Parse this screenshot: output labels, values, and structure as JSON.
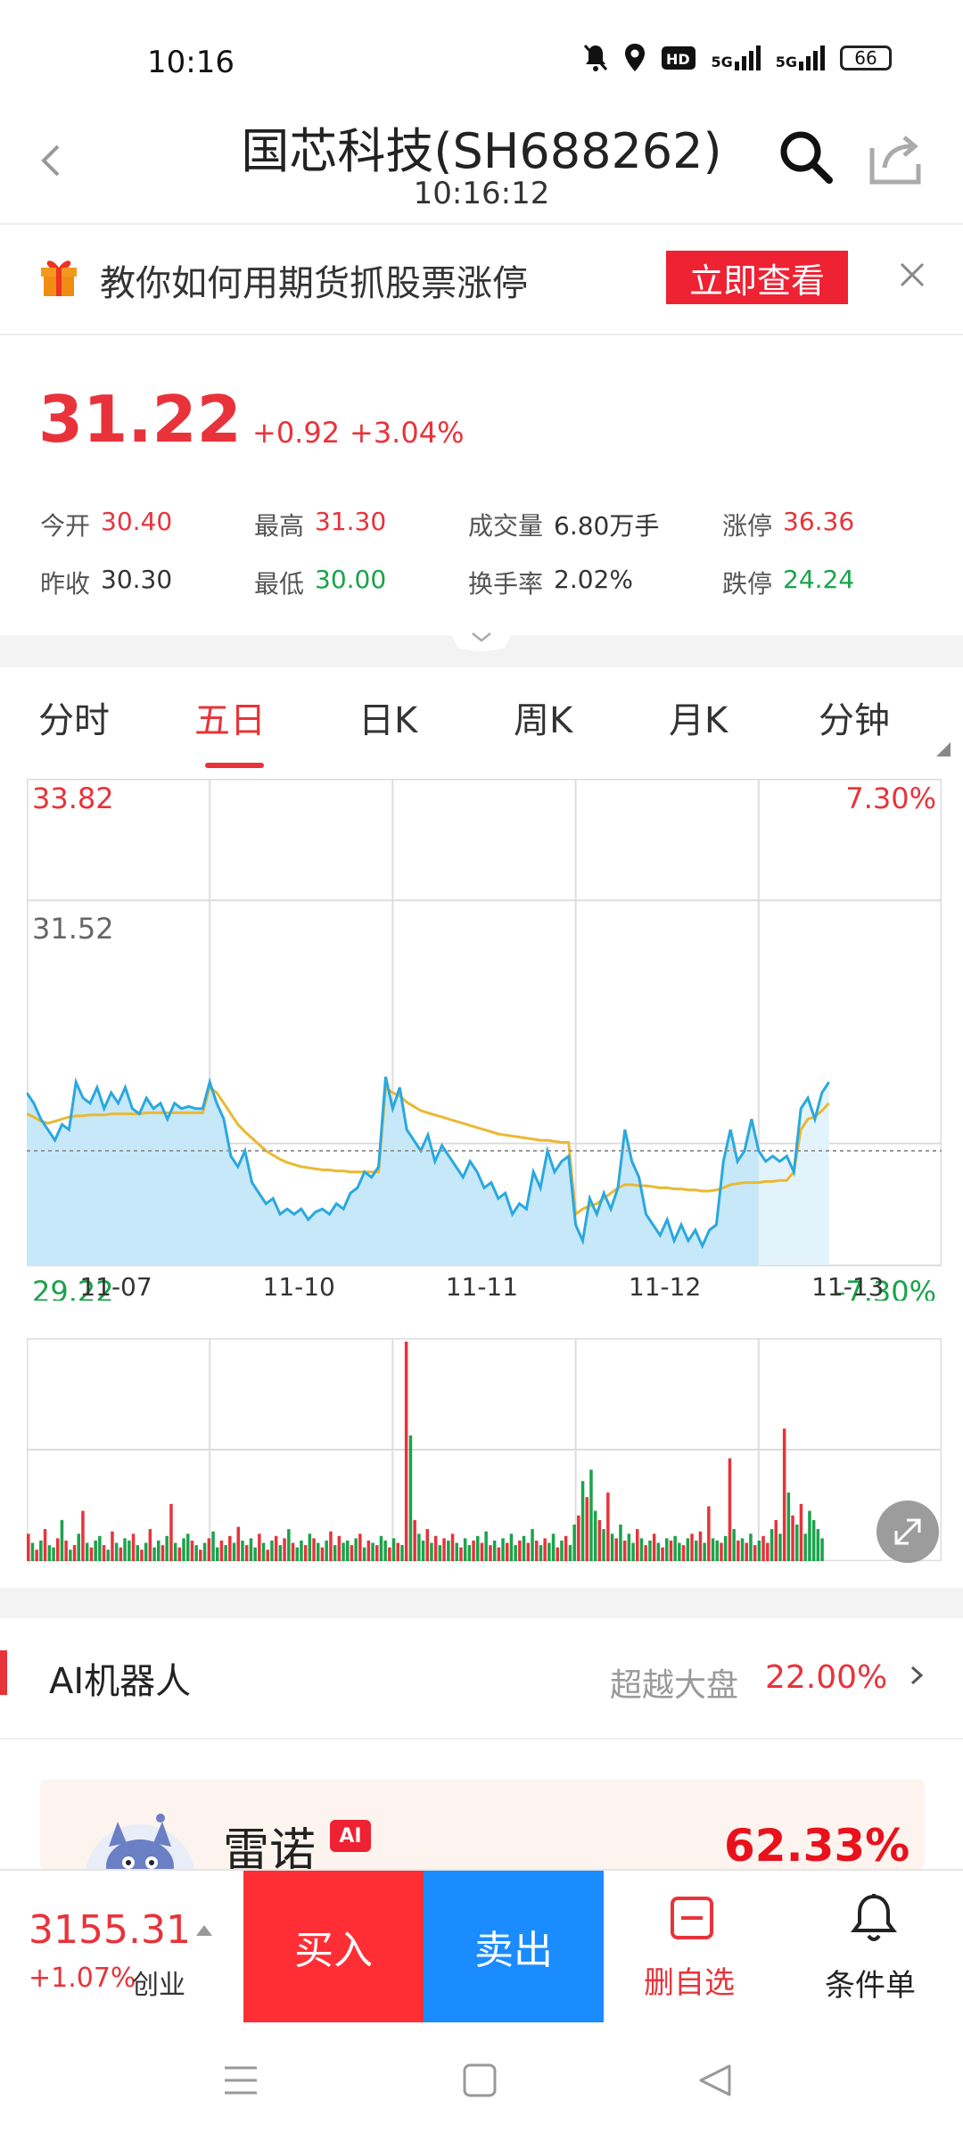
{
  "status_bar": {
    "time": "10:16",
    "network_1": "5G",
    "network_2": "5G",
    "battery": "66"
  },
  "header": {
    "title": "国芯科技(SH688262)",
    "time": "10:16:12"
  },
  "banner": {
    "text": "教你如何用期货抓股票涨停",
    "button": "立即查看"
  },
  "quote": {
    "price": "31.22",
    "change": "+0.92",
    "change_pct": "+3.04%",
    "stats": {
      "open_label": "今开",
      "open": "30.40",
      "high_label": "最高",
      "high": "31.30",
      "volume_label": "成交量",
      "volume": "6.80万手",
      "limit_up_label": "涨停",
      "limit_up": "36.36",
      "prev_close_label": "昨收",
      "prev_close": "30.30",
      "low_label": "最低",
      "low": "30.00",
      "turnover_label": "换手率",
      "turnover": "2.02%",
      "limit_down_label": "跌停",
      "limit_down": "24.24"
    }
  },
  "tabs": [
    {
      "label": "分时"
    },
    {
      "label": "五日"
    },
    {
      "label": "日K"
    },
    {
      "label": "周K"
    },
    {
      "label": "月K"
    },
    {
      "label": "分钟"
    }
  ],
  "active_tab": "五日",
  "chart_data": {
    "type": "line",
    "y_top": "33.82",
    "y_mid": "31.52",
    "y_bottom": "29.22",
    "pct_top": "7.30%",
    "pct_bottom": "-7.30%",
    "ylim": [
      29.22,
      33.82
    ],
    "ref_price": 30.3,
    "x_labels": [
      "11-07",
      "11-10",
      "11-11",
      "11-12",
      "11-13"
    ],
    "series": [
      {
        "values": [
          30.85,
          30.75,
          30.6,
          30.5,
          30.4,
          30.55,
          30.5,
          30.95,
          30.8,
          30.75,
          30.9,
          30.7,
          30.85,
          30.75,
          30.9,
          30.7,
          30.65,
          30.8,
          30.7,
          30.75,
          30.6,
          30.75,
          30.7,
          30.72,
          30.7,
          30.7,
          30.95,
          30.75,
          30.6,
          30.25,
          30.15,
          30.3,
          30.0,
          29.9,
          29.8,
          29.85,
          29.7,
          29.75,
          29.7,
          29.75,
          29.65,
          29.72,
          29.75,
          29.7,
          29.8,
          29.75,
          29.9,
          29.95,
          30.1,
          30.05,
          30.15,
          31.0,
          30.7,
          30.9,
          30.5,
          30.4,
          30.3,
          30.45,
          30.2,
          30.35,
          30.25,
          30.15,
          30.05,
          30.2,
          30.1,
          29.95,
          30.0,
          29.85,
          29.9,
          29.7,
          29.8,
          29.75,
          30.1,
          29.95,
          30.3,
          30.1,
          30.2,
          30.25,
          29.6,
          29.45,
          29.85,
          29.7,
          29.9,
          29.75,
          29.95,
          30.5,
          30.2,
          30.05,
          29.7,
          29.6,
          29.5,
          29.65,
          29.45,
          29.6,
          29.45,
          29.55,
          29.4,
          29.55,
          29.6,
          30.2,
          30.5,
          30.2,
          30.3,
          30.6,
          30.3,
          30.2,
          30.25,
          30.2,
          30.25,
          30.1,
          30.7,
          30.8,
          30.6,
          30.85,
          30.95
        ],
        "avg": [
          30.65,
          30.62,
          30.58,
          30.56,
          30.58,
          30.6,
          30.62,
          30.63,
          30.63,
          30.64,
          30.64,
          30.64,
          30.65,
          30.65,
          30.65,
          30.65,
          30.65,
          30.66,
          30.66,
          30.66,
          30.66,
          30.66,
          30.66,
          30.66,
          30.66,
          30.66,
          30.9,
          30.85,
          30.75,
          30.65,
          30.55,
          30.48,
          30.42,
          30.36,
          30.3,
          30.26,
          30.22,
          30.19,
          30.17,
          30.15,
          30.14,
          30.13,
          30.12,
          30.12,
          30.11,
          30.11,
          30.1,
          30.1,
          30.1,
          30.1,
          30.1,
          30.9,
          30.85,
          30.82,
          30.76,
          30.72,
          30.68,
          30.66,
          30.64,
          30.62,
          30.6,
          30.58,
          30.56,
          30.54,
          30.52,
          30.5,
          30.48,
          30.46,
          30.45,
          30.44,
          30.43,
          30.42,
          30.41,
          30.4,
          30.4,
          30.39,
          30.38,
          30.38,
          29.7,
          29.75,
          29.78,
          29.8,
          29.85,
          29.9,
          29.95,
          29.98,
          29.98,
          29.97,
          29.97,
          29.96,
          29.95,
          29.95,
          29.94,
          29.94,
          29.93,
          29.93,
          29.92,
          29.92,
          29.93,
          29.95,
          29.98,
          29.99,
          30.0,
          30.0,
          30.0,
          30.01,
          30.01,
          30.02,
          30.02,
          30.1,
          30.5,
          30.6,
          30.62,
          30.68,
          30.75
        ]
      }
    ]
  },
  "volume_data": {
    "values": [
      12,
      8,
      5,
      9,
      14,
      7,
      6,
      10,
      18,
      9,
      5,
      7,
      12,
      22,
      8,
      6,
      9,
      11,
      7,
      5,
      13,
      8,
      6,
      10,
      9,
      12,
      7,
      5,
      8,
      14,
      6,
      9,
      7,
      11,
      25,
      8,
      6,
      10,
      12,
      9,
      7,
      5,
      8,
      10,
      13,
      6,
      9,
      7,
      11,
      8,
      15,
      9,
      7,
      10,
      6,
      12,
      8,
      5,
      9,
      11,
      7,
      10,
      14,
      8,
      6,
      9,
      7,
      12,
      10,
      8,
      6,
      9,
      13,
      7,
      11,
      8,
      9,
      7,
      10,
      12,
      6,
      9,
      8,
      7,
      11,
      9,
      6,
      10,
      8,
      7,
      96,
      55,
      18,
      12,
      9,
      14,
      8,
      11,
      7,
      10,
      9,
      12,
      8,
      6,
      10,
      7,
      9,
      11,
      8,
      13,
      7,
      9,
      6,
      10,
      8,
      12,
      7,
      9,
      11,
      8,
      14,
      9,
      7,
      10,
      8,
      12,
      6,
      9,
      11,
      7,
      16,
      20,
      35,
      28,
      40,
      22,
      18,
      14,
      30,
      12,
      10,
      16,
      9,
      12,
      8,
      14,
      10,
      7,
      9,
      12,
      8,
      6,
      10,
      9,
      11,
      8,
      7,
      10,
      12,
      9,
      13,
      8,
      24,
      10,
      9,
      8,
      11,
      45,
      14,
      9,
      10,
      8,
      12,
      7,
      9,
      11,
      8,
      14,
      18,
      12,
      58,
      30,
      20,
      16,
      25,
      12,
      22,
      18,
      14,
      10
    ],
    "colors": [
      "r",
      "g",
      "r",
      "g",
      "r",
      "g",
      "g",
      "r",
      "g",
      "r",
      "g",
      "r",
      "g",
      "r",
      "g",
      "r",
      "g",
      "g",
      "r",
      "g",
      "r",
      "g",
      "r",
      "g",
      "g",
      "r",
      "g",
      "r",
      "g",
      "r",
      "g",
      "g",
      "r",
      "g",
      "r",
      "g",
      "r",
      "g",
      "g",
      "r",
      "g",
      "r",
      "g",
      "r",
      "g",
      "g",
      "r",
      "g",
      "r",
      "g",
      "r",
      "g",
      "r",
      "g",
      "g",
      "r",
      "g",
      "r",
      "g",
      "r",
      "g",
      "r",
      "g",
      "r",
      "g",
      "g",
      "r",
      "g",
      "r",
      "g",
      "r",
      "g",
      "r",
      "g",
      "r",
      "g",
      "g",
      "r",
      "g",
      "r",
      "g",
      "r",
      "g",
      "r",
      "g",
      "g",
      "r",
      "g",
      "r",
      "g",
      "r",
      "g",
      "r",
      "g",
      "g",
      "r",
      "g",
      "r",
      "g",
      "r",
      "g",
      "r",
      "g",
      "r",
      "g",
      "g",
      "r",
      "g",
      "r",
      "g",
      "r",
      "g",
      "r",
      "g",
      "r",
      "g",
      "g",
      "r",
      "g",
      "r",
      "g",
      "r",
      "g",
      "r",
      "g",
      "g",
      "r",
      "g",
      "r",
      "g",
      "g",
      "r",
      "g",
      "r",
      "g",
      "g",
      "r",
      "g",
      "r",
      "g",
      "r",
      "g",
      "r",
      "g",
      "g",
      "r",
      "g",
      "r",
      "g",
      "r",
      "g",
      "r",
      "g",
      "r",
      "g",
      "g",
      "r",
      "g",
      "r",
      "g",
      "r",
      "g",
      "r",
      "g",
      "g",
      "r",
      "g",
      "r",
      "g",
      "r",
      "g",
      "r",
      "g",
      "r",
      "g",
      "r",
      "r",
      "g",
      "r",
      "g",
      "r",
      "g",
      "r",
      "g",
      "r",
      "g"
    ]
  },
  "ai_robot": {
    "title": "AI机器人",
    "beat_label": "超越大盘",
    "beat_value": "22.00%",
    "robot_name": "雷诺",
    "badge": "AI",
    "return": "62.33%"
  },
  "bottom_bar": {
    "index_value": "3155.31",
    "index_change": "+1.07%",
    "index_name": "创业",
    "buy": "买入",
    "sell": "卖出",
    "remove_watch": "删自选",
    "condition_order": "条件单"
  },
  "colors": {
    "up": "#e8333a",
    "down": "#1aa34a",
    "price_line": "#29a8e0",
    "avg_line": "#eab932",
    "area_fill": "#c7e8f8"
  }
}
